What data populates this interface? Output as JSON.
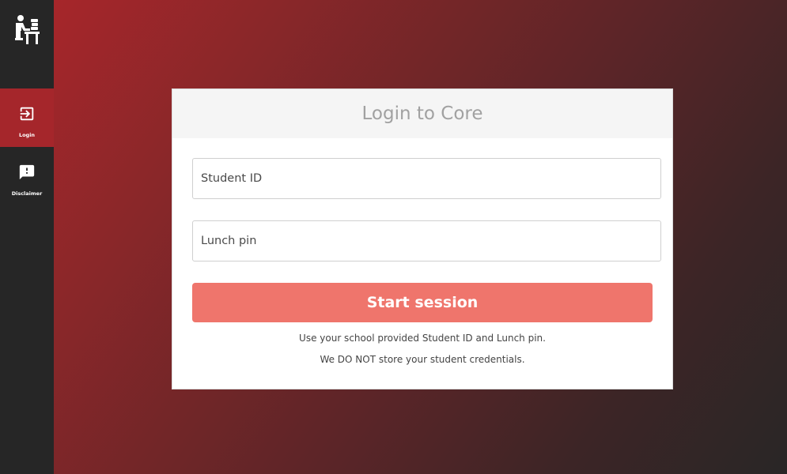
{
  "sidebar": {
    "logo_icon": "person-at-desk-icon",
    "items": [
      {
        "label": "Login",
        "icon": "login-icon",
        "active": true
      },
      {
        "label": "Disclaimer",
        "icon": "alert-message-icon",
        "active": false
      }
    ]
  },
  "login_card": {
    "title": "Login to Core",
    "student_id": {
      "placeholder": "Student ID",
      "value": ""
    },
    "lunch_pin": {
      "placeholder": "Lunch pin",
      "value": ""
    },
    "submit_label": "Start session",
    "note_1": "Use your school provided Student ID and Lunch pin.",
    "note_2": "We DO NOT store your student credentials."
  },
  "colors": {
    "sidebar_bg": "#262626",
    "active_nav_bg": "#a5262b",
    "button_bg": "#ef756c",
    "background_gradient_start": "#ad262b",
    "background_gradient_end": "#292626"
  }
}
